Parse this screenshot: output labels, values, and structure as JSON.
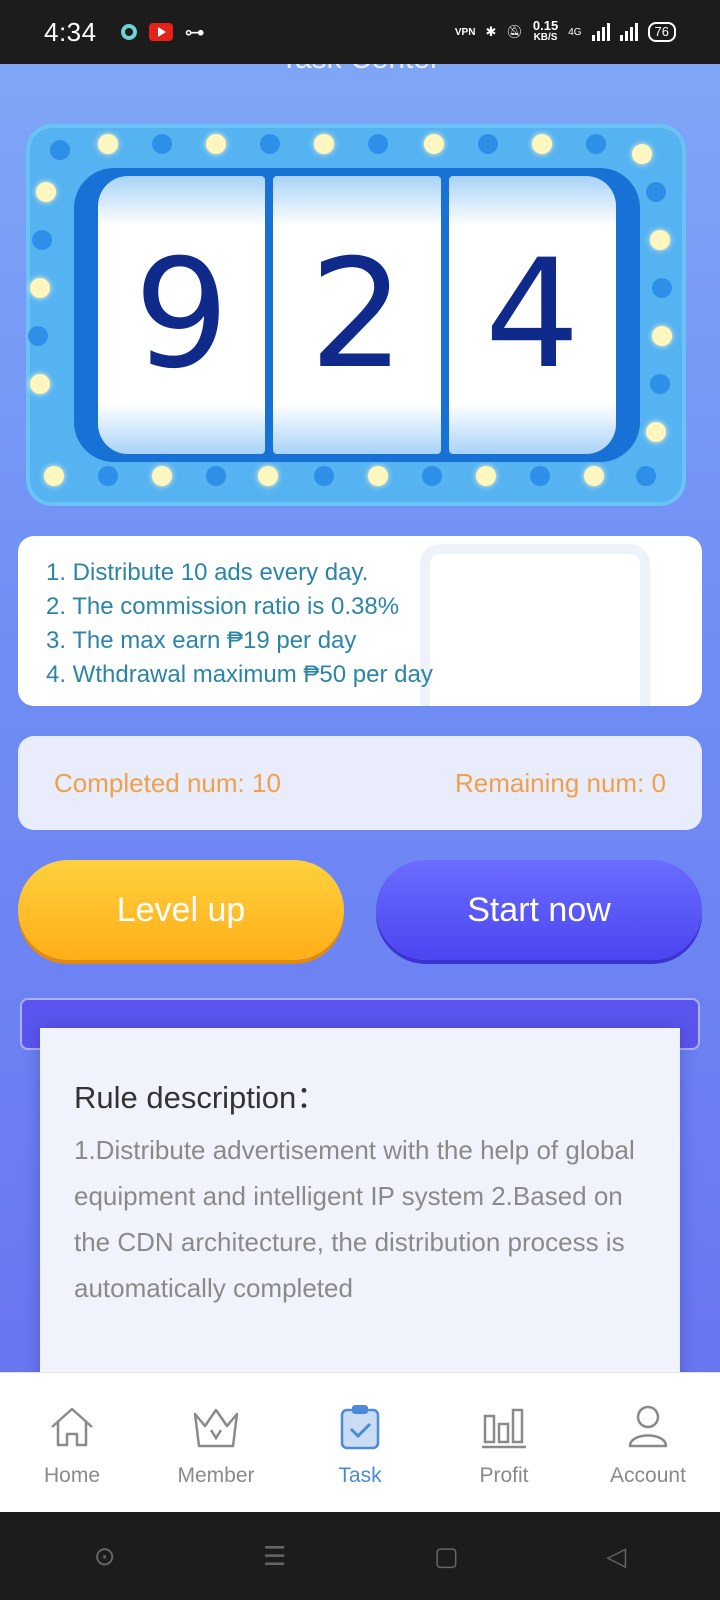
{
  "status_bar": {
    "time": "4:34",
    "net_speed_value": "0.15",
    "net_speed_unit": "KB/S",
    "network_type": "4G",
    "vpn_label": "VPN",
    "battery": "76"
  },
  "page": {
    "title": "Task Center"
  },
  "slot": {
    "digits": [
      "9",
      "2",
      "4"
    ]
  },
  "info": {
    "lines": [
      "1. Distribute 10 ads every day.",
      "2. The commission ratio is 0.38%",
      "3. The max earn ₱19 per day",
      "4. Wthdrawal maximum ₱50 per day"
    ]
  },
  "counts": {
    "completed": "Completed num: 10",
    "remaining": "Remaining num: 0"
  },
  "buttons": {
    "level_up": "Level up",
    "start_now": "Start now"
  },
  "rules": {
    "title": "Rule description：",
    "text": "1.Distribute advertisement with the help of global equipment and intelligent IP system 2.Based on the CDN architecture, the distribution process is automatically completed"
  },
  "nav": {
    "items": [
      {
        "label": "Home",
        "icon": "home-icon"
      },
      {
        "label": "Member",
        "icon": "crown-icon"
      },
      {
        "label": "Task",
        "icon": "clipboard-check-icon"
      },
      {
        "label": "Profit",
        "icon": "bar-chart-icon"
      },
      {
        "label": "Account",
        "icon": "user-icon"
      }
    ],
    "active": "Task"
  },
  "colors": {
    "accent": "#4a8ad6",
    "level_button": "#ffb51f",
    "start_button": "#5654f4",
    "info_text": "#2a85a8",
    "count_text": "#f0a04a"
  }
}
